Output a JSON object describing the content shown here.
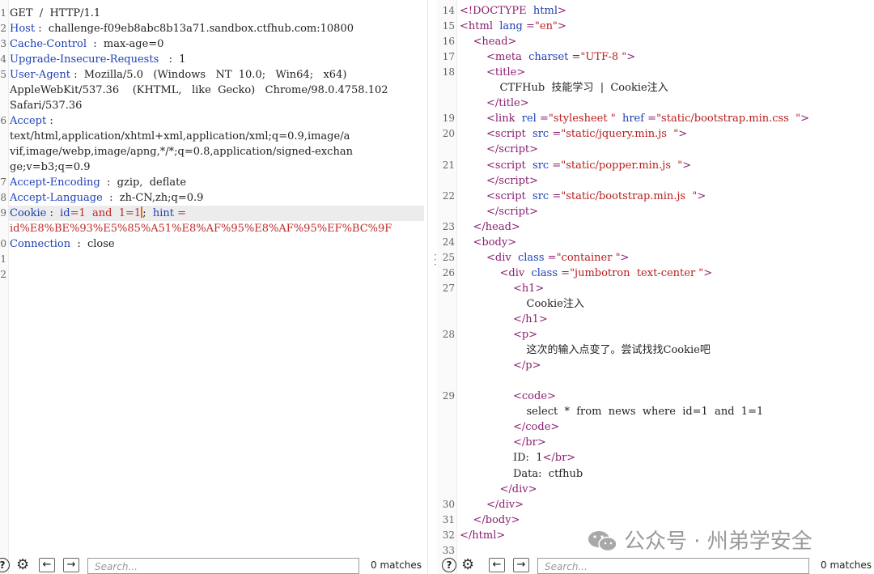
{
  "request": {
    "line_numbers": [
      "1",
      "2",
      "3",
      "4",
      "5",
      "6",
      "",
      "",
      "7",
      "",
      "",
      "",
      "8",
      "9",
      "0",
      "",
      "",
      "0",
      "1",
      "2"
    ],
    "lines": [
      {
        "parts": [
          {
            "t": "GET  /  HTTP/1.1",
            "c": "v"
          }
        ]
      },
      {
        "parts": [
          {
            "t": "Host",
            "c": "k"
          },
          {
            "t": " :  challenge-f09eb8abc8b13a71.sandbox.ctfhub.com:10800",
            "c": "v"
          }
        ]
      },
      {
        "parts": [
          {
            "t": "Cache-Control",
            "c": "k"
          },
          {
            "t": "  :  max-age=0",
            "c": "v"
          }
        ]
      },
      {
        "parts": [
          {
            "t": "Upgrade-Insecure-Requests",
            "c": "k"
          },
          {
            "t": "   :  1",
            "c": "v"
          }
        ]
      },
      {
        "parts": [
          {
            "t": "User-Agent",
            "c": "k"
          },
          {
            "t": " :  Mozilla/5.0   (Windows   NT  10.0;   Win64;   x64)",
            "c": "v"
          }
        ]
      },
      {
        "parts": [
          {
            "t": "AppleWebKit/537.36    (KHTML,   like  Gecko)   Chrome/98.0.4758.102",
            "c": "v"
          }
        ]
      },
      {
        "parts": [
          {
            "t": "Safari/537.36",
            "c": "v"
          }
        ]
      },
      {
        "parts": [
          {
            "t": "Accept",
            "c": "k"
          },
          {
            "t": " :",
            "c": "v"
          }
        ]
      },
      {
        "parts": [
          {
            "t": "text/html,application/xhtml+xml,application/xml;q=0.9,image/a",
            "c": "v"
          }
        ]
      },
      {
        "parts": [
          {
            "t": "vif,image/webp,image/apng,*/*;q=0.8,application/signed-exchan",
            "c": "v"
          }
        ]
      },
      {
        "parts": [
          {
            "t": "ge;v=b3;q=0.9",
            "c": "v"
          }
        ]
      },
      {
        "parts": [
          {
            "t": "Accept-Encoding",
            "c": "k"
          },
          {
            "t": "  :  gzip,  deflate",
            "c": "v"
          }
        ]
      },
      {
        "parts": [
          {
            "t": "Accept-Language",
            "c": "k"
          },
          {
            "t": "  :  zh-CN,zh;q=0.9",
            "c": "v"
          }
        ]
      },
      {
        "parts": [
          {
            "t": "Cookie",
            "c": "k"
          },
          {
            "t": " :  ",
            "c": "v"
          },
          {
            "t": "id",
            "c": "k"
          },
          {
            "t": "=1  and  1=1",
            "c": "red"
          },
          {
            "t": "CURSOR",
            "c": "cursor"
          },
          {
            "t": ";  ",
            "c": "v"
          },
          {
            "t": "hint",
            "c": "k"
          },
          {
            "t": " =",
            "c": "red"
          }
        ]
      },
      {
        "parts": [
          {
            "t": "id%E8%BE%93%E5%85%A51%E8%AF%95%E8%AF%95%EF%BC%9F",
            "c": "red"
          }
        ]
      },
      {
        "parts": [
          {
            "t": "Connection",
            "c": "k"
          },
          {
            "t": "  :  close",
            "c": "v"
          }
        ]
      },
      {
        "parts": []
      },
      {
        "parts": []
      }
    ],
    "gutter_labels": [
      "1",
      "2",
      "3",
      "4",
      "5",
      "",
      "",
      "6",
      "",
      "",
      "",
      "7",
      "8",
      "9",
      "",
      "0",
      "1",
      "2"
    ]
  },
  "response": {
    "lines": [
      {
        "n": "14",
        "i": 0,
        "parts": [
          {
            "t": "<!DOCTYPE  ",
            "c": "tag"
          },
          {
            "t": "html",
            "c": "attr"
          },
          {
            "t": ">",
            "c": "tag"
          }
        ]
      },
      {
        "n": "15",
        "i": 0,
        "parts": [
          {
            "t": "<html  ",
            "c": "tag"
          },
          {
            "t": "lang",
            "c": "attr"
          },
          {
            "t": " =",
            "c": "tag"
          },
          {
            "t": "\"en\"",
            "c": "str"
          },
          {
            "t": ">",
            "c": "tag"
          }
        ]
      },
      {
        "n": "16",
        "i": 1,
        "parts": [
          {
            "t": "<head",
            "c": "tag"
          },
          {
            "t": ">",
            "c": "tag"
          }
        ]
      },
      {
        "n": "17",
        "i": 2,
        "parts": [
          {
            "t": "<meta  ",
            "c": "tag"
          },
          {
            "t": "charset",
            "c": "attr"
          },
          {
            "t": " =",
            "c": "tag"
          },
          {
            "t": "\"UTF-8 \"",
            "c": "str"
          },
          {
            "t": ">",
            "c": "tag"
          }
        ]
      },
      {
        "n": "18",
        "i": 2,
        "parts": [
          {
            "t": "<title",
            "c": "tag"
          },
          {
            "t": ">",
            "c": "tag"
          }
        ]
      },
      {
        "n": "",
        "i": 3,
        "parts": [
          {
            "t": "CTFHub  技能学习  |  Cookie注入",
            "c": "txt"
          }
        ]
      },
      {
        "n": "",
        "i": 2,
        "parts": [
          {
            "t": "</title",
            "c": "tag"
          },
          {
            "t": ">",
            "c": "tag"
          }
        ]
      },
      {
        "n": "19",
        "i": 2,
        "parts": [
          {
            "t": "<link  ",
            "c": "tag"
          },
          {
            "t": "rel",
            "c": "attr"
          },
          {
            "t": " =",
            "c": "tag"
          },
          {
            "t": "\"stylesheet \"",
            "c": "str"
          },
          {
            "t": "  ",
            "c": "tag"
          },
          {
            "t": "href",
            "c": "attr"
          },
          {
            "t": " =",
            "c": "tag"
          },
          {
            "t": "\"static/bootstrap.min.css  \"",
            "c": "str"
          },
          {
            "t": ">",
            "c": "tag"
          }
        ]
      },
      {
        "n": "20",
        "i": 2,
        "parts": [
          {
            "t": "<script  ",
            "c": "tag"
          },
          {
            "t": "src",
            "c": "attr"
          },
          {
            "t": " =",
            "c": "tag"
          },
          {
            "t": "\"static/jquery.min.js  \"",
            "c": "str"
          },
          {
            "t": ">",
            "c": "tag"
          }
        ]
      },
      {
        "n": "",
        "i": 2,
        "parts": [
          {
            "t": "</script",
            "c": "tag"
          },
          {
            "t": ">",
            "c": "tag"
          }
        ]
      },
      {
        "n": "21",
        "i": 2,
        "parts": [
          {
            "t": "<script  ",
            "c": "tag"
          },
          {
            "t": "src",
            "c": "attr"
          },
          {
            "t": " =",
            "c": "tag"
          },
          {
            "t": "\"static/popper.min.js  \"",
            "c": "str"
          },
          {
            "t": ">",
            "c": "tag"
          }
        ]
      },
      {
        "n": "",
        "i": 2,
        "parts": [
          {
            "t": "</script",
            "c": "tag"
          },
          {
            "t": ">",
            "c": "tag"
          }
        ]
      },
      {
        "n": "22",
        "i": 2,
        "parts": [
          {
            "t": "<script  ",
            "c": "tag"
          },
          {
            "t": "src",
            "c": "attr"
          },
          {
            "t": " =",
            "c": "tag"
          },
          {
            "t": "\"static/bootstrap.min.js  \"",
            "c": "str"
          },
          {
            "t": ">",
            "c": "tag"
          }
        ]
      },
      {
        "n": "",
        "i": 2,
        "parts": [
          {
            "t": "</script",
            "c": "tag"
          },
          {
            "t": ">",
            "c": "tag"
          }
        ]
      },
      {
        "n": "23",
        "i": 1,
        "parts": [
          {
            "t": "</head",
            "c": "tag"
          },
          {
            "t": ">",
            "c": "tag"
          }
        ]
      },
      {
        "n": "24",
        "i": 1,
        "parts": [
          {
            "t": "<body",
            "c": "tag"
          },
          {
            "t": ">",
            "c": "tag"
          }
        ]
      },
      {
        "n": "25",
        "i": 2,
        "parts": [
          {
            "t": "<div  ",
            "c": "tag"
          },
          {
            "t": "class",
            "c": "attr"
          },
          {
            "t": " =",
            "c": "tag"
          },
          {
            "t": "\"container \"",
            "c": "str"
          },
          {
            "t": ">",
            "c": "tag"
          }
        ]
      },
      {
        "n": "26",
        "i": 3,
        "parts": [
          {
            "t": "<div  ",
            "c": "tag"
          },
          {
            "t": "class",
            "c": "attr"
          },
          {
            "t": " =",
            "c": "tag"
          },
          {
            "t": "\"jumbotron  text-center \"",
            "c": "str"
          },
          {
            "t": ">",
            "c": "tag"
          }
        ]
      },
      {
        "n": "27",
        "i": 4,
        "parts": [
          {
            "t": "<h1",
            "c": "tag"
          },
          {
            "t": ">",
            "c": "tag"
          }
        ]
      },
      {
        "n": "",
        "i": 5,
        "parts": [
          {
            "t": "Cookie注入",
            "c": "txt"
          }
        ]
      },
      {
        "n": "",
        "i": 4,
        "parts": [
          {
            "t": "</h1",
            "c": "tag"
          },
          {
            "t": ">",
            "c": "tag"
          }
        ]
      },
      {
        "n": "28",
        "i": 4,
        "parts": [
          {
            "t": "<p",
            "c": "tag"
          },
          {
            "t": ">",
            "c": "tag"
          }
        ]
      },
      {
        "n": "",
        "i": 5,
        "parts": [
          {
            "t": "这次的输入点变了。尝试找找Cookie吧",
            "c": "txt"
          }
        ]
      },
      {
        "n": "",
        "i": 4,
        "parts": [
          {
            "t": "</p",
            "c": "tag"
          },
          {
            "t": ">",
            "c": "tag"
          }
        ]
      },
      {
        "n": "",
        "i": 0,
        "parts": []
      },
      {
        "n": "29",
        "i": 4,
        "parts": [
          {
            "t": "<code",
            "c": "tag"
          },
          {
            "t": ">",
            "c": "tag"
          }
        ]
      },
      {
        "n": "",
        "i": 5,
        "parts": [
          {
            "t": "select  *  from  news  where  id=1  and  1=1",
            "c": "txt"
          }
        ]
      },
      {
        "n": "",
        "i": 4,
        "parts": [
          {
            "t": "</code",
            "c": "tag"
          },
          {
            "t": ">",
            "c": "tag"
          }
        ]
      },
      {
        "n": "",
        "i": 4,
        "parts": [
          {
            "t": "</br",
            "c": "tag"
          },
          {
            "t": ">",
            "c": "tag"
          }
        ]
      },
      {
        "n": "",
        "i": 4,
        "parts": [
          {
            "t": "ID:  1",
            "c": "txt"
          },
          {
            "t": "</br",
            "c": "tag"
          },
          {
            "t": ">",
            "c": "tag"
          }
        ]
      },
      {
        "n": "",
        "i": 4,
        "parts": [
          {
            "t": "Data:  ctfhub",
            "c": "txt"
          }
        ]
      },
      {
        "n": "",
        "i": 3,
        "parts": [
          {
            "t": "</div",
            "c": "tag"
          },
          {
            "t": ">",
            "c": "tag"
          }
        ]
      },
      {
        "n": "30",
        "i": 2,
        "parts": [
          {
            "t": "</div",
            "c": "tag"
          },
          {
            "t": ">",
            "c": "tag"
          }
        ]
      },
      {
        "n": "31",
        "i": 1,
        "parts": [
          {
            "t": "</body",
            "c": "tag"
          },
          {
            "t": ">",
            "c": "tag"
          }
        ]
      },
      {
        "n": "32",
        "i": 0,
        "parts": [
          {
            "t": "</html",
            "c": "tag"
          },
          {
            "t": ">",
            "c": "tag"
          }
        ]
      },
      {
        "n": "33",
        "i": 0,
        "parts": []
      }
    ]
  },
  "toolbar": {
    "help_label": "?",
    "search_placeholder": "Search...",
    "matches_label": "0 matches"
  },
  "watermark": {
    "text": "公众号 · 州弟学安全"
  },
  "colors": {
    "header_key": "#1d3fb5",
    "tag": "#8a1f70",
    "string": "#b81e1e",
    "cookie_value": "#c02828"
  }
}
